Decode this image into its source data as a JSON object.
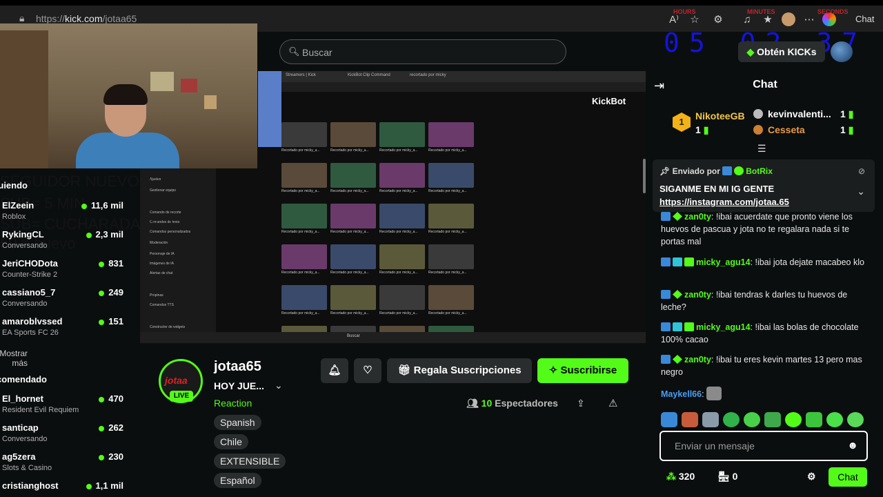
{
  "browser": {
    "url_prefix": "https://",
    "url_domain": "kick.com",
    "url_path": "/jotaa65",
    "red_labels": [
      "HOURS",
      "MINUTES",
      "SECONDS"
    ],
    "chat_label": "Chat"
  },
  "timer": {
    "hours": "05",
    "minutes": "02",
    "seconds": "37"
  },
  "overlay": {
    "line1": "SEGUIDOR NUEVO = 30 MIN",
    "line2": "SUB= 5 MIN",
    "line3": "SUB= CUCHARADA DE SAL",
    "line4": "50 = huevo"
  },
  "sidebar": {
    "rec_header": "Recomendado",
    "show_more": "Mostrar más",
    "top_partial": "Siguiendo",
    "top": [
      {
        "name": "ElZeein",
        "cat": "Roblox",
        "viewers": "11,6 mil"
      },
      {
        "name": "RykingCL",
        "cat": "Conversando",
        "viewers": "2,3 mil"
      },
      {
        "name": "JeriCHODota",
        "cat": "Counter-Strike 2",
        "viewers": "831"
      },
      {
        "name": "cassiano5_7",
        "cat": "Conversando",
        "viewers": "249"
      },
      {
        "name": "amaroblvssed",
        "cat": "EA Sports FC 26",
        "viewers": "151"
      }
    ],
    "rec": [
      {
        "name": "El_hornet",
        "cat": "Resident Evil Requiem",
        "viewers": "470"
      },
      {
        "name": "santicap",
        "cat": "Conversando",
        "viewers": "262"
      },
      {
        "name": "ag5zera",
        "cat": "Slots & Casino",
        "viewers": "230"
      },
      {
        "name": "cristianghost",
        "cat": "",
        "viewers": "1,1 mil"
      }
    ]
  },
  "search": {
    "placeholder": "Buscar"
  },
  "video": {
    "brand": "KickBot",
    "clip_label": "Recortado por micky_a...",
    "side_items": [
      "Ajustes",
      "Gestionar equipo",
      "Comando de recorte",
      "Comandos de texto",
      "Comandos personalizados",
      "Moderación",
      "Personaje de IA",
      "Imágenes de IA",
      "Alertas de chat",
      "Propinas",
      "Comandos TTS",
      "Constructor de widgets"
    ],
    "taskbar_search": "Buscar"
  },
  "channel": {
    "name": "jotaa65",
    "title": "HOY JUE...",
    "category": "Reaction",
    "live": "LIVE",
    "tags": [
      "Spanish",
      "Chile",
      "EXTENSIBLE",
      "Español"
    ],
    "gift_btn": "Regala Suscripciones",
    "sub_btn": "Suscribirse",
    "viewers_count": "10",
    "viewers_label": "Espectadores"
  },
  "chat": {
    "header": "Chat",
    "kicks_btn": "Obtén KICKs",
    "leaderboard": [
      {
        "rank": "1",
        "name": "NikoteeGB",
        "count": "1"
      },
      {
        "name": "kevinvalenti...",
        "count": "1"
      },
      {
        "name": "Cesseta",
        "count": "1"
      }
    ],
    "pinned": {
      "by_label": "Enviado por",
      "by_user": "BotRix",
      "text": "SIGANME EN MI IG GENTE",
      "link": "https://instagram.com/jotaa.65"
    },
    "messages": [
      {
        "user": "zan0ty",
        "text": "!ibai acuerdate que pronto viene los huevos de pascua y jota no te regalara nada si te portas mal"
      },
      {
        "user": "micky_agu14",
        "text": "!ibai jota dejate macabeo klo"
      },
      {
        "user": "zan0ty",
        "text": "!ibai tendras k darles tu huevos de leche?"
      },
      {
        "user": "micky_agu14",
        "text": "!ibai las bolas de chocolate 100% cacao"
      },
      {
        "user": "zan0ty",
        "text": "!ibai tu eres kevin martes 13 pero mas negro"
      },
      {
        "user": "Maykell66",
        "text": ""
      }
    ],
    "input_placeholder": "Enviar un mensaje",
    "points": "320",
    "store_count": "0",
    "send_btn": "Chat",
    "colors": {
      "accent": "#53fc18",
      "link": "#4a9ff5"
    }
  }
}
